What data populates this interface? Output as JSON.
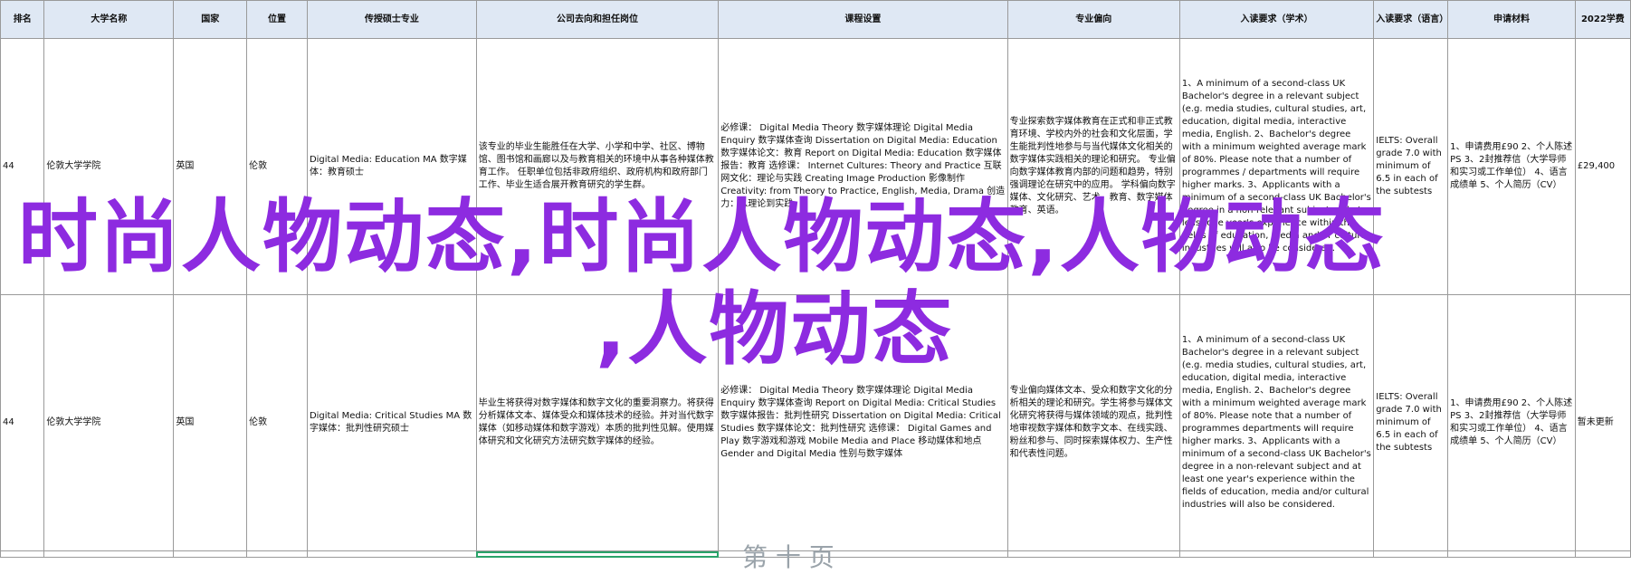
{
  "headers": [
    "排名",
    "大学名称",
    "国家",
    "位置",
    "传授硕士专业",
    "公司去向和担任岗位",
    "课程设置",
    "专业偏向",
    "入读要求（学术）",
    "入读要求（语言）",
    "申请材料",
    "2022学费"
  ],
  "row1": {
    "rank": "44",
    "university": "伦敦大学学院",
    "country": "英国",
    "location": "伦敦",
    "program": "Digital Media: Education MA\n数字媒体：教育硕士",
    "career": "该专业的毕业生能胜任在大学、小学和中学、社区、博物馆、图书馆和画廊以及与教育相关的环境中从事各种媒体教育工作。\n任职单位包括非政府组织、政府机构和政府部门工作、毕业生适合展开教育研究的学生群。",
    "courses": "必修课：\nDigital Media Theory\n数字媒体理论\nDigital Media Enquiry\n数字媒体查询\nDissertation on Digital Media: Education\n数字媒体论文：教育\nReport on Digital Media: Education\n数字媒体报告：教育\n\n选修课：\nInternet Cultures: Theory and Practice\n互联网文化：理论与实践\nCreating Image Production\n影像制作\nCreativity: from Theory to Practice, English, Media, Drama\n创造力：从理论到实践",
    "focus": "专业探索数字媒体教育在正式和非正式教育环境、学校内外的社会和文化层面，学生能批判性地参与与当代媒体文化相关的数字媒体实践相关的理论和研究。\n专业偏向数字媒体教育内部的问题和趋势，特别强调理论在研究中的应用。\n学科偏向数字媒体、文化研究、艺术、教育、数字媒体教育、英语。",
    "academic": "1、A minimum of a second-class UK Bachelor's degree in a relevant subject (e.g. media studies, cultural studies, art, education, digital media, interactive media, English.\n2、Bachelor's degree with a minimum weighted average mark of 80%. Please note that a number of programmes / departments will require higher marks.\n3、Applicants with a minimum of a second-class UK Bachelor's degree in a non-relevant subject and at least one year's experience within the fields of education, media and/or cultural industries will also be considered.",
    "language": "IELTS:\nOverall grade 7.0 with minimum of 6.5 in each of the subtests",
    "materials": "1、申请费用£90\n2、个人陈述PS\n3、2封推荐信（大学导师和实习或工作单位）\n4、语言成绩单\n5、个人简历（CV）",
    "fee": "£29,400"
  },
  "row2": {
    "rank": "44",
    "university": "伦敦大学学院",
    "country": "英国",
    "location": "伦敦",
    "program": "Digital Media: Critical Studies MA\n数字媒体：批判性研究硕士",
    "career": "毕业生将获得对数字媒体和数字文化的重要洞察力。将获得分析媒体文本、媒体受众和媒体技术的经验。并对当代数字媒体（如移动媒体和数字游戏）本质的批判性见解。使用媒体研究和文化研究方法研究数字媒体的经验。",
    "courses": "必修课：\nDigital Media Theory\n数字媒体理论\nDigital Media Enquiry\n数字媒体查询\nReport on Digital Media: Critical Studies\n数字媒体报告：批判性研究\nDissertation on Digital Media: Critical Studies\n数字媒体论文：批判性研究\n\n选修课：\nDigital Games and Play\n数字游戏和游戏\nMobile Media and Place\n移动媒体和地点\nGender and Digital Media\n性别与数字媒体",
    "focus": "专业偏向媒体文本、受众和数字文化的分析相关的理论和研究。学生将参与媒体文化研究将获得与媒体领域的观点，批判性地审视数字媒体和数字文本、在线实践、粉丝和参与、同时探索媒体权力、生产性和代表性问题。",
    "academic": "1、A minimum of a second-class UK Bachelor's degree in a relevant subject (e.g. media studies, cultural studies, art, education, digital media, interactive media, English.\n2、Bachelor's degree with a minimum weighted average mark of 80%. Please note that a number of programmes departments will require higher marks.\n3、Applicants with a minimum of a second-class UK Bachelor's degree in a non-relevant subject and at least one year's experience within the fields of education, media and/or cultural industries will also be considered.",
    "language": "IELTS:\nOverall grade 7.0 with minimum of 6.5 in each of the subtests",
    "materials": "1、申请费用£90\n2、个人陈述PS\n3、2封推荐信（大学导师和实习或工作单位）\n4、语言成绩单\n5、个人简历（CV）",
    "fee": "暂未更新"
  },
  "watermark": {
    "line1": "时尚人物动态,时尚人物动态,人物动态",
    "line2": ",人物动态"
  },
  "bottom_faint_text": "第 十 页",
  "colors": {
    "header_bg": "#dfe8f4",
    "grid": "#9a9a9a",
    "watermark": "#8d2be0",
    "selection": "#2aa36a"
  }
}
